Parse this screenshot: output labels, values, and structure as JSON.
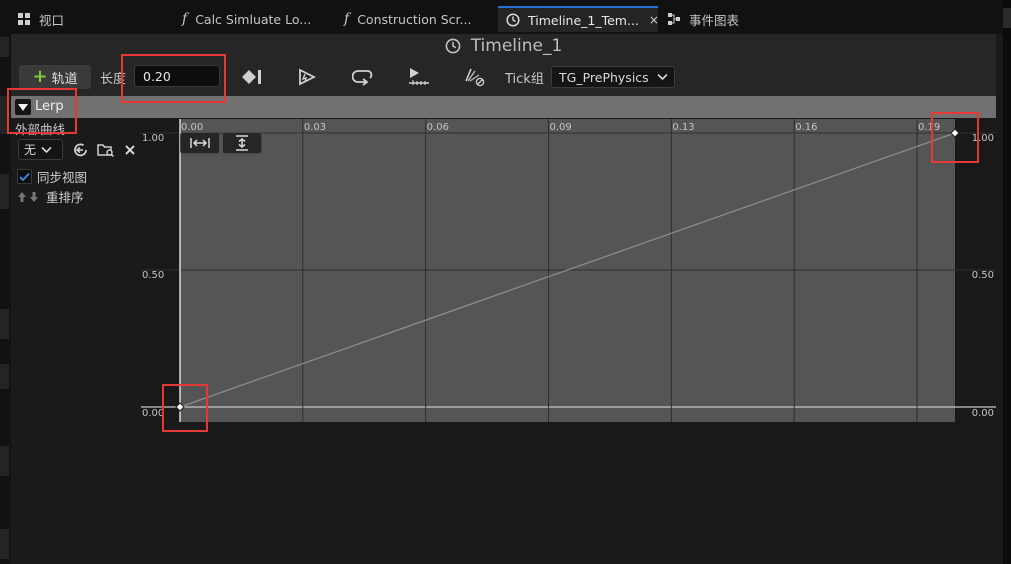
{
  "tabs": [
    {
      "label": "视口",
      "icon": "grid-icon"
    },
    {
      "label": "Calc Simluate Lo...",
      "icon": "function-icon"
    },
    {
      "label": "Construction Scr...",
      "icon": "function-icon"
    },
    {
      "label": "Timeline_1_Tem...",
      "icon": "clock-icon",
      "close": "×"
    },
    {
      "label": "事件图表",
      "icon": "graph-icon"
    }
  ],
  "title": "Timeline_1",
  "toolbar": {
    "add_track_label": "轨道",
    "length_label": "长度",
    "length_value": "0.20",
    "tick_group_label": "Tick组",
    "tick_group_value": "TG_PrePhysics"
  },
  "track": {
    "name": "Lerp"
  },
  "left_panel": {
    "external_curve_label": "外部曲线",
    "curve_select_value": "无",
    "sync_view_label": "同步视图",
    "sync_view_checked": true,
    "reorder_label": "重排序"
  },
  "graph": {
    "x_ticks": [
      "0.00",
      "0.03",
      "0.06",
      "0.09",
      "0.13",
      "0.16",
      "0.19"
    ],
    "y_ticks_left": [
      "1.00",
      "0.50",
      "0.00"
    ],
    "y_ticks_right": [
      "1.00",
      "0.50",
      "0.00"
    ],
    "keys": [
      {
        "time": 0.0,
        "value": 0.0
      },
      {
        "time": 0.2,
        "value": 1.0
      }
    ],
    "colors": {
      "curve": "#8f8f8f",
      "active": "#555555",
      "outside": "#191919",
      "highlight": "#e53935"
    }
  }
}
